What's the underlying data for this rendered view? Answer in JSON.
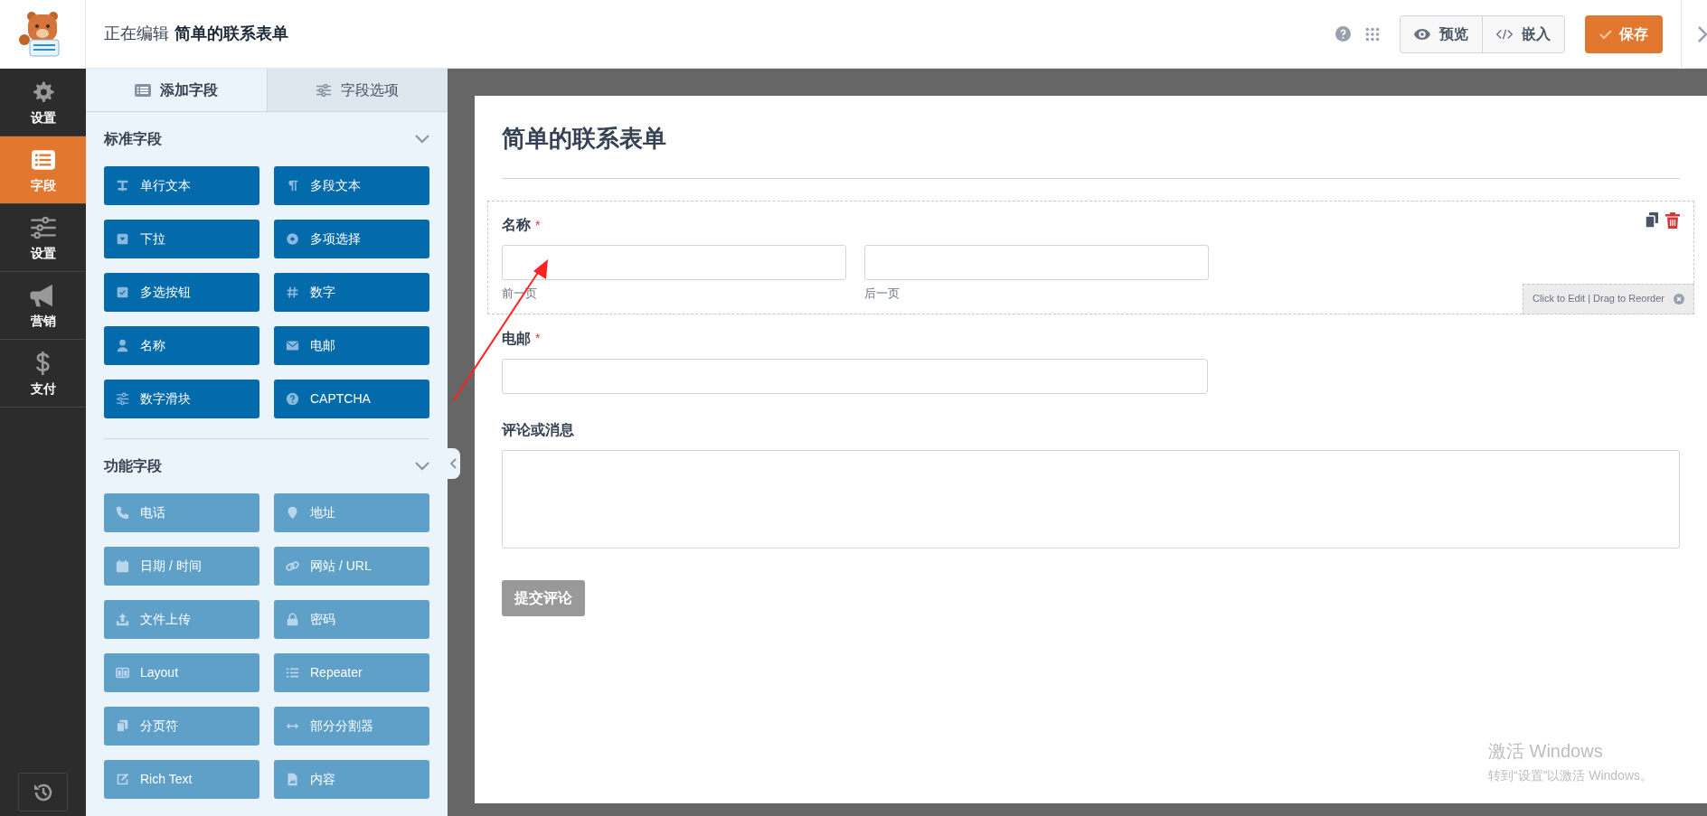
{
  "header": {
    "editing_label": "正在编辑",
    "form_name": "简单的联系表单",
    "actions": [
      {
        "label": "预览"
      },
      {
        "label": "嵌入"
      }
    ],
    "save_label": "保存"
  },
  "nav": [
    {
      "label": "设置",
      "selected": false
    },
    {
      "label": "字段",
      "selected": true
    },
    {
      "label": "设置",
      "selected": false
    },
    {
      "label": "营销",
      "selected": false
    },
    {
      "label": "支付",
      "selected": false
    }
  ],
  "panel": {
    "tabs": [
      {
        "label": "添加字段",
        "selected": true
      },
      {
        "label": "字段选项",
        "selected": false
      }
    ],
    "sections": [
      {
        "title": "标准字段",
        "kind": "standard",
        "expanded": true,
        "fields": [
          "单行文本",
          "多段文本",
          "下拉",
          "多项选择",
          "多选按钮",
          "数字",
          "名称",
          "电邮",
          "数字滑块",
          "CAPTCHA"
        ]
      },
      {
        "title": "功能字段",
        "kind": "advanced",
        "expanded": true,
        "fields": [
          "电话",
          "地址",
          "日期 / 时间",
          "网站 / URL",
          "文件上传",
          "密码",
          "Layout",
          "Repeater",
          "分页符",
          "部分分割器",
          "Rich Text",
          "内容"
        ]
      }
    ]
  },
  "form": {
    "title": "简单的联系表单",
    "fields": [
      {
        "kind": "name",
        "label": "名称",
        "required_mark": "*",
        "hovered": true,
        "sublabels": [
          "前一页",
          "后一页"
        ]
      },
      {
        "kind": "email",
        "label": "电邮",
        "required_mark": "*",
        "hovered": false
      },
      {
        "kind": "textarea",
        "label": "评论或消息",
        "hovered": false
      }
    ],
    "hover_hint": "Click to Edit | Drag to Reorder",
    "submit": "提交评论"
  },
  "os_notice": {
    "title": "激活 Windows",
    "text": "转到“设置”以激活 Windows。"
  }
}
